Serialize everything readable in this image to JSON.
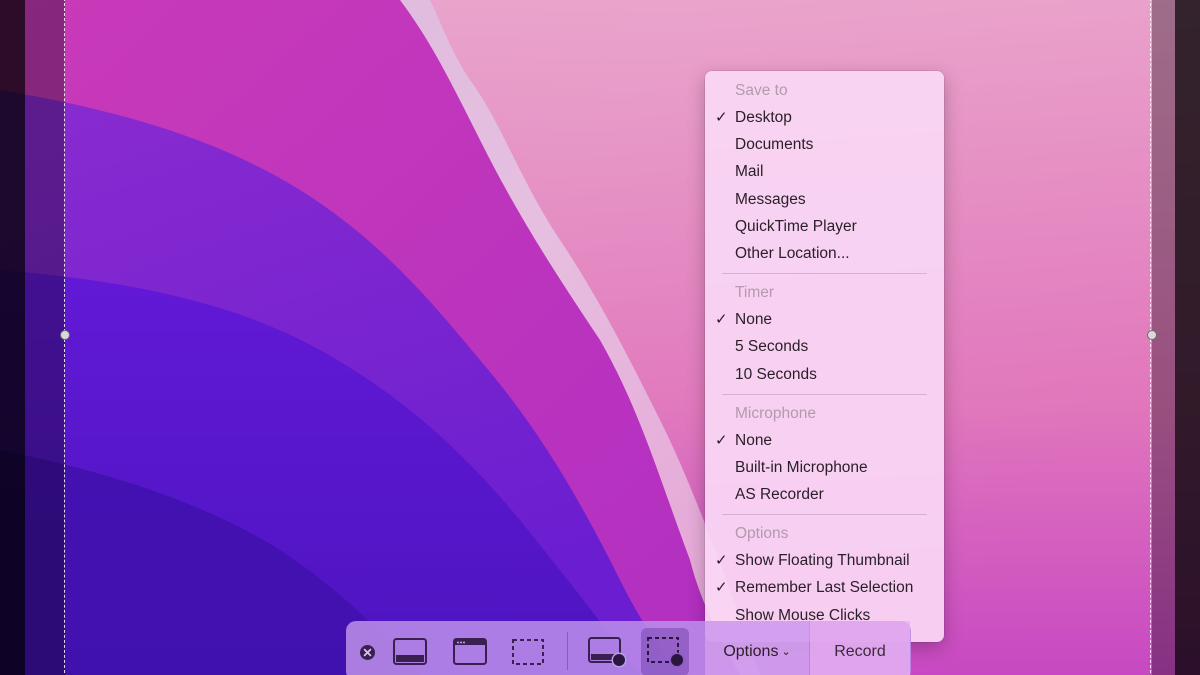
{
  "menu": {
    "sections": [
      {
        "header": "Save to",
        "items": [
          {
            "label": "Desktop",
            "checked": true
          },
          {
            "label": "Documents",
            "checked": false
          },
          {
            "label": "Mail",
            "checked": false
          },
          {
            "label": "Messages",
            "checked": false
          },
          {
            "label": "QuickTime Player",
            "checked": false
          },
          {
            "label": "Other Location...",
            "checked": false
          }
        ]
      },
      {
        "header": "Timer",
        "items": [
          {
            "label": "None",
            "checked": true
          },
          {
            "label": "5 Seconds",
            "checked": false
          },
          {
            "label": "10 Seconds",
            "checked": false
          }
        ]
      },
      {
        "header": "Microphone",
        "items": [
          {
            "label": "None",
            "checked": true
          },
          {
            "label": "Built-in Microphone",
            "checked": false
          },
          {
            "label": "AS Recorder",
            "checked": false
          }
        ]
      },
      {
        "header": "Options",
        "items": [
          {
            "label": "Show Floating Thumbnail",
            "checked": true
          },
          {
            "label": "Remember Last Selection",
            "checked": true
          },
          {
            "label": "Show Mouse Clicks",
            "checked": false
          }
        ]
      }
    ],
    "check_glyph": "✓"
  },
  "toolbar": {
    "options_label": "Options",
    "options_chevron": "⌄",
    "record_label": "Record",
    "buttons": [
      {
        "icon": "capture-entire-screen-icon"
      },
      {
        "icon": "capture-window-icon"
      },
      {
        "icon": "capture-selection-icon"
      },
      {
        "icon": "record-entire-screen-icon"
      },
      {
        "icon": "record-selection-icon",
        "active": true
      }
    ]
  },
  "colors": {
    "menu_bg": "#fad7f5",
    "toolbar_bg": "#ba8ce8",
    "text": "#2b2029",
    "header_text": "#b39aac"
  }
}
